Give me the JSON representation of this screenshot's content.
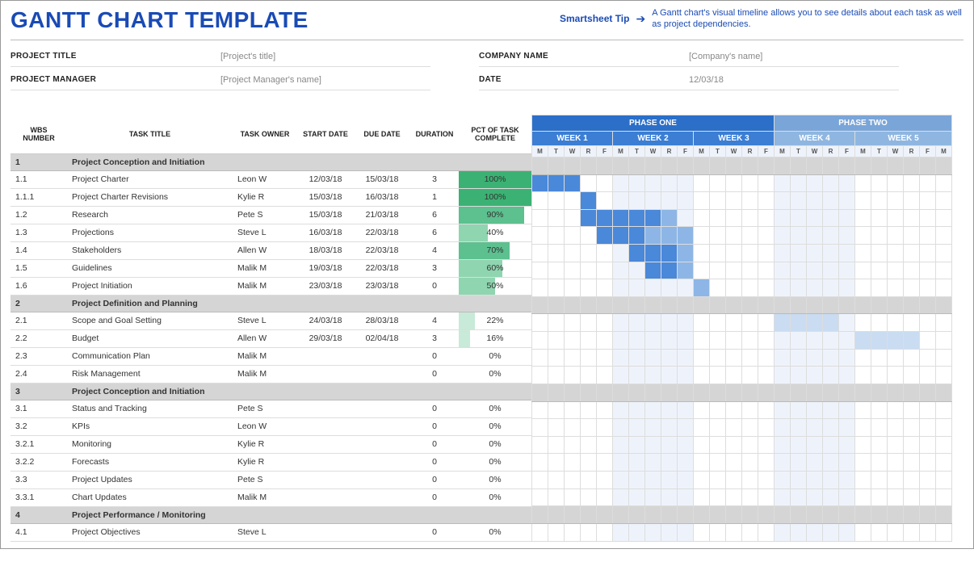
{
  "header": {
    "title": "GANTT CHART TEMPLATE",
    "tip_label": "Smartsheet Tip",
    "tip_text": "A Gantt chart's visual timeline allows you to see details about each task as well as project dependencies."
  },
  "meta": {
    "project_title_label": "PROJECT TITLE",
    "project_title_value": "[Project's title]",
    "project_manager_label": "PROJECT MANAGER",
    "project_manager_value": "[Project Manager's name]",
    "company_name_label": "COMPANY NAME",
    "company_name_value": "[Company's name]",
    "date_label": "DATE",
    "date_value": "12/03/18"
  },
  "columns": {
    "wbs": "WBS NUMBER",
    "title": "TASK TITLE",
    "owner": "TASK OWNER",
    "start": "START DATE",
    "due": "DUE DATE",
    "duration": "DURATION",
    "pct": "PCT OF TASK COMPLETE"
  },
  "phases": [
    {
      "label": "PHASE ONE",
      "weeks": [
        "WEEK 1",
        "WEEK 2",
        "WEEK 3"
      ],
      "class": "phase1"
    },
    {
      "label": "PHASE TWO",
      "weeks": [
        "WEEK 4",
        "WEEK 5"
      ],
      "class": "phase2"
    }
  ],
  "days": [
    "M",
    "T",
    "W",
    "R",
    "F"
  ],
  "rows": [
    {
      "type": "section",
      "wbs": "1",
      "title": "Project Conception and Initiation"
    },
    {
      "wbs": "1.1",
      "title": "Project Charter",
      "owner": "Leon W",
      "start": "12/03/18",
      "due": "15/03/18",
      "dur": "3",
      "pct": 100,
      "bar": [
        0,
        3,
        "bar1"
      ]
    },
    {
      "wbs": "1.1.1",
      "title": "Project Charter Revisions",
      "owner": "Kylie R",
      "start": "15/03/18",
      "due": "16/03/18",
      "dur": "1",
      "pct": 100,
      "bar": [
        3,
        1,
        "bar1"
      ]
    },
    {
      "wbs": "1.2",
      "title": "Research",
      "owner": "Pete S",
      "start": "15/03/18",
      "due": "21/03/18",
      "dur": "6",
      "pct": 90,
      "bars": [
        [
          3,
          5,
          "bar1"
        ],
        [
          8,
          1,
          "bar1l"
        ]
      ]
    },
    {
      "wbs": "1.3",
      "title": "Projections",
      "owner": "Steve L",
      "start": "16/03/18",
      "due": "22/03/18",
      "dur": "6",
      "pct": 40,
      "bars": [
        [
          4,
          3,
          "bar1"
        ],
        [
          7,
          3,
          "bar1l"
        ]
      ]
    },
    {
      "wbs": "1.4",
      "title": "Stakeholders",
      "owner": "Allen W",
      "start": "18/03/18",
      "due": "22/03/18",
      "dur": "4",
      "pct": 70,
      "bars": [
        [
          6,
          3,
          "bar1"
        ],
        [
          9,
          1,
          "bar1l"
        ]
      ]
    },
    {
      "wbs": "1.5",
      "title": "Guidelines",
      "owner": "Malik M",
      "start": "19/03/18",
      "due": "22/03/18",
      "dur": "3",
      "pct": 60,
      "bars": [
        [
          7,
          2,
          "bar1"
        ],
        [
          9,
          1,
          "bar1l"
        ]
      ]
    },
    {
      "wbs": "1.6",
      "title": "Project Initiation",
      "owner": "Malik M",
      "start": "23/03/18",
      "due": "23/03/18",
      "dur": "0",
      "pct": 50,
      "bars": [
        [
          10,
          1,
          "bar1l"
        ]
      ]
    },
    {
      "type": "section",
      "wbs": "2",
      "title": "Project Definition and Planning"
    },
    {
      "wbs": "2.1",
      "title": "Scope and Goal Setting",
      "owner": "Steve L",
      "start": "24/03/18",
      "due": "28/03/18",
      "dur": "4",
      "pct": 22,
      "bars": [
        [
          15,
          1,
          "bar2"
        ],
        [
          16,
          3,
          "bar2"
        ]
      ]
    },
    {
      "wbs": "2.2",
      "title": "Budget",
      "owner": "Allen W",
      "start": "29/03/18",
      "due": "02/04/18",
      "dur": "3",
      "pct": 16,
      "bars": [
        [
          20,
          4,
          "bar2"
        ]
      ]
    },
    {
      "wbs": "2.3",
      "title": "Communication Plan",
      "owner": "Malik M",
      "start": "",
      "due": "",
      "dur": "0",
      "pct": 0
    },
    {
      "wbs": "2.4",
      "title": "Risk Management",
      "owner": "Malik M",
      "start": "",
      "due": "",
      "dur": "0",
      "pct": 0
    },
    {
      "type": "section",
      "wbs": "3",
      "title": "Project Conception and Initiation"
    },
    {
      "wbs": "3.1",
      "title": "Status and Tracking",
      "owner": "Pete S",
      "start": "",
      "due": "",
      "dur": "0",
      "pct": 0
    },
    {
      "wbs": "3.2",
      "title": "KPIs",
      "owner": "Leon W",
      "start": "",
      "due": "",
      "dur": "0",
      "pct": 0
    },
    {
      "wbs": "3.2.1",
      "title": "Monitoring",
      "owner": "Kylie R",
      "start": "",
      "due": "",
      "dur": "0",
      "pct": 0
    },
    {
      "wbs": "3.2.2",
      "title": "Forecasts",
      "owner": "Kylie R",
      "start": "",
      "due": "",
      "dur": "0",
      "pct": 0
    },
    {
      "wbs": "3.3",
      "title": "Project Updates",
      "owner": "Pete S",
      "start": "",
      "due": "",
      "dur": "0",
      "pct": 0
    },
    {
      "wbs": "3.3.1",
      "title": "Chart Updates",
      "owner": "Malik M",
      "start": "",
      "due": "",
      "dur": "0",
      "pct": 0
    },
    {
      "type": "section",
      "wbs": "4",
      "title": "Project Performance / Monitoring"
    },
    {
      "wbs": "4.1",
      "title": "Project Objectives",
      "owner": "Steve L",
      "start": "",
      "due": "",
      "dur": "0",
      "pct": 0
    }
  ],
  "chart_data": {
    "type": "gantt",
    "title": "GANTT CHART TEMPLATE",
    "timeline": {
      "unit": "workday",
      "start": "12/03/18",
      "phases": [
        {
          "name": "PHASE ONE",
          "weeks": [
            "WEEK 1",
            "WEEK 2",
            "WEEK 3"
          ]
        },
        {
          "name": "PHASE TWO",
          "weeks": [
            "WEEK 4",
            "WEEK 5"
          ]
        }
      ],
      "days_per_week": [
        "M",
        "T",
        "W",
        "R",
        "F"
      ]
    },
    "tasks": [
      {
        "wbs": "1",
        "title": "Project Conception and Initiation",
        "section": true
      },
      {
        "wbs": "1.1",
        "title": "Project Charter",
        "owner": "Leon W",
        "start": "12/03/18",
        "due": "15/03/18",
        "duration": 3,
        "pct_complete": 100
      },
      {
        "wbs": "1.1.1",
        "title": "Project Charter Revisions",
        "owner": "Kylie R",
        "start": "15/03/18",
        "due": "16/03/18",
        "duration": 1,
        "pct_complete": 100
      },
      {
        "wbs": "1.2",
        "title": "Research",
        "owner": "Pete S",
        "start": "15/03/18",
        "due": "21/03/18",
        "duration": 6,
        "pct_complete": 90
      },
      {
        "wbs": "1.3",
        "title": "Projections",
        "owner": "Steve L",
        "start": "16/03/18",
        "due": "22/03/18",
        "duration": 6,
        "pct_complete": 40
      },
      {
        "wbs": "1.4",
        "title": "Stakeholders",
        "owner": "Allen W",
        "start": "18/03/18",
        "due": "22/03/18",
        "duration": 4,
        "pct_complete": 70
      },
      {
        "wbs": "1.5",
        "title": "Guidelines",
        "owner": "Malik M",
        "start": "19/03/18",
        "due": "22/03/18",
        "duration": 3,
        "pct_complete": 60
      },
      {
        "wbs": "1.6",
        "title": "Project Initiation",
        "owner": "Malik M",
        "start": "23/03/18",
        "due": "23/03/18",
        "duration": 0,
        "pct_complete": 50
      },
      {
        "wbs": "2",
        "title": "Project Definition and Planning",
        "section": true
      },
      {
        "wbs": "2.1",
        "title": "Scope and Goal Setting",
        "owner": "Steve L",
        "start": "24/03/18",
        "due": "28/03/18",
        "duration": 4,
        "pct_complete": 22
      },
      {
        "wbs": "2.2",
        "title": "Budget",
        "owner": "Allen W",
        "start": "29/03/18",
        "due": "02/04/18",
        "duration": 3,
        "pct_complete": 16
      },
      {
        "wbs": "2.3",
        "title": "Communication Plan",
        "owner": "Malik M",
        "duration": 0,
        "pct_complete": 0
      },
      {
        "wbs": "2.4",
        "title": "Risk Management",
        "owner": "Malik M",
        "duration": 0,
        "pct_complete": 0
      },
      {
        "wbs": "3",
        "title": "Project Conception and Initiation",
        "section": true
      },
      {
        "wbs": "3.1",
        "title": "Status and Tracking",
        "owner": "Pete S",
        "duration": 0,
        "pct_complete": 0
      },
      {
        "wbs": "3.2",
        "title": "KPIs",
        "owner": "Leon W",
        "duration": 0,
        "pct_complete": 0
      },
      {
        "wbs": "3.2.1",
        "title": "Monitoring",
        "owner": "Kylie R",
        "duration": 0,
        "pct_complete": 0
      },
      {
        "wbs": "3.2.2",
        "title": "Forecasts",
        "owner": "Kylie R",
        "duration": 0,
        "pct_complete": 0
      },
      {
        "wbs": "3.3",
        "title": "Project Updates",
        "owner": "Pete S",
        "duration": 0,
        "pct_complete": 0
      },
      {
        "wbs": "3.3.1",
        "title": "Chart Updates",
        "owner": "Malik M",
        "duration": 0,
        "pct_complete": 0
      },
      {
        "wbs": "4",
        "title": "Project Performance / Monitoring",
        "section": true
      },
      {
        "wbs": "4.1",
        "title": "Project Objectives",
        "owner": "Steve L",
        "duration": 0,
        "pct_complete": 0
      }
    ]
  }
}
